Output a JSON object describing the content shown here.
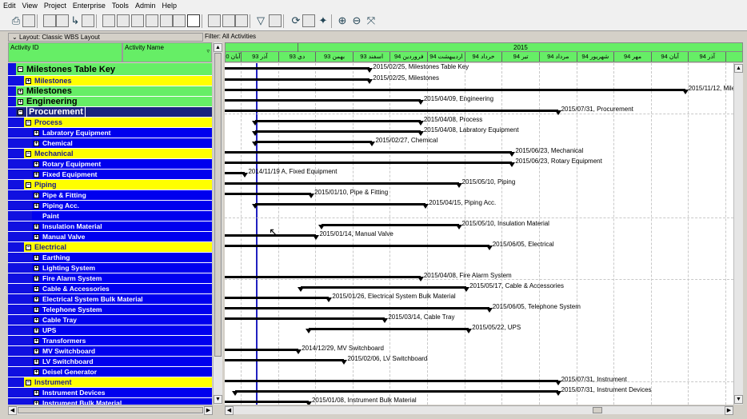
{
  "menu": [
    "Edit",
    "View",
    "Project",
    "Enterprise",
    "Tools",
    "Admin",
    "Help"
  ],
  "layout_label": "Layout: Classic WBS Layout",
  "filter_label": "Filter: All Activities",
  "columns": {
    "activity_id": "Activity ID",
    "activity_name": "Activity Name"
  },
  "timescale": {
    "year": "2015",
    "months": [
      "آبان 0",
      "آذر 93",
      "دي 93",
      "بهمن 93",
      "اسفند 93",
      "فروردين 94",
      "ارديبهشت 94",
      "خرداد 94",
      "تير 94",
      "مرداد 94",
      "شهريور 94",
      "مهر 94",
      "آبان 94",
      "آذر 94"
    ]
  },
  "rows": [
    {
      "label": "Milestones Table Key",
      "level": 0,
      "exp": "−",
      "big": true
    },
    {
      "label": "Milestones",
      "level": 1,
      "exp": "+"
    },
    {
      "label": "Milestones",
      "level": 0,
      "exp": "+"
    },
    {
      "label": "Engineering",
      "level": 0,
      "exp": "+"
    },
    {
      "label": "Procurement",
      "level": 0,
      "exp": "−",
      "sel": true
    },
    {
      "label": "Process",
      "level": 1,
      "exp": "−"
    },
    {
      "label": "Labratory Equipment",
      "level": 2,
      "exp": "+"
    },
    {
      "label": "Chemical",
      "level": 2,
      "exp": "+"
    },
    {
      "label": "Mechanical",
      "level": 1,
      "exp": "−"
    },
    {
      "label": "Rotary Equipment",
      "level": 2,
      "exp": "+"
    },
    {
      "label": "Fixed Equipment",
      "level": 2,
      "exp": "+"
    },
    {
      "label": "Piping",
      "level": 1,
      "exp": "−"
    },
    {
      "label": "Pipe & Fitting",
      "level": 2,
      "exp": "+"
    },
    {
      "label": "Piping Acc.",
      "level": 2,
      "exp": "+"
    },
    {
      "label": "Paint",
      "level": 2,
      "exp": ""
    },
    {
      "label": "Insulation Material",
      "level": 2,
      "exp": "+"
    },
    {
      "label": "Manual Valve",
      "level": 2,
      "exp": "+"
    },
    {
      "label": "Electrical",
      "level": 1,
      "exp": "−"
    },
    {
      "label": "Earthing",
      "level": 2,
      "exp": "+"
    },
    {
      "label": "Lighting System",
      "level": 2,
      "exp": "+"
    },
    {
      "label": "Fire Alarm System",
      "level": 2,
      "exp": "+"
    },
    {
      "label": "Cable & Accessories",
      "level": 2,
      "exp": "+"
    },
    {
      "label": "Electrical System Bulk Material",
      "level": 2,
      "exp": "+"
    },
    {
      "label": "Telephone System",
      "level": 2,
      "exp": "+"
    },
    {
      "label": "Cable Tray",
      "level": 2,
      "exp": "+"
    },
    {
      "label": "UPS",
      "level": 2,
      "exp": "+"
    },
    {
      "label": "Transformers",
      "level": 2,
      "exp": "+"
    },
    {
      "label": "MV Switchboard",
      "level": 2,
      "exp": "+"
    },
    {
      "label": "LV Switchboard",
      "level": 2,
      "exp": "+"
    },
    {
      "label": "Deisel Generator",
      "level": 2,
      "exp": "+"
    },
    {
      "label": "Instrument",
      "level": 1,
      "exp": "−"
    },
    {
      "label": "Instrument Devices",
      "level": 2,
      "exp": "+"
    },
    {
      "label": "Instrument Bulk Material",
      "level": 2,
      "exp": "+"
    }
  ],
  "bars": [
    {
      "label": "2015/02/25, Milestones Table Key",
      "start": 0.0,
      "end": 0.285
    },
    {
      "label": "2015/02/25, Milestones",
      "start": 0.0,
      "end": 0.285
    },
    {
      "label": "2015/11/12, Mile",
      "start": 0.0,
      "end": 0.905
    },
    {
      "label": "2015/04/09, Engineering",
      "start": 0.0,
      "end": 0.385
    },
    {
      "label": "2015/07/31, Procurement",
      "start": 0.0,
      "end": 0.655
    },
    {
      "label": "2015/04/08, Process",
      "start": 0.06,
      "end": 0.385
    },
    {
      "label": "2015/04/08, Labratory Equipment",
      "start": 0.06,
      "end": 0.385
    },
    {
      "label": "2015/02/27, Chemical",
      "start": 0.06,
      "end": 0.29
    },
    {
      "label": "2015/06/23, Mechanical",
      "start": 0.0,
      "end": 0.565
    },
    {
      "label": "2015/06/23, Rotary Equipment",
      "start": 0.0,
      "end": 0.565
    },
    {
      "label": "2014/11/19 A, Fixed Equipment",
      "start": 0.0,
      "end": 0.04
    },
    {
      "label": "2015/05/10, Piping",
      "start": 0.0,
      "end": 0.46
    },
    {
      "label": "2015/01/10, Pipe & Fitting",
      "start": 0.0,
      "end": 0.17
    },
    {
      "label": "2015/04/15, Piping Acc.",
      "start": 0.06,
      "end": 0.395
    },
    {
      "label": "",
      "start": 0,
      "end": 0
    },
    {
      "label": "2015/05/10, Insulation Material",
      "start": 0.19,
      "end": 0.46
    },
    {
      "label": "2015/01/14, Manual Valve",
      "start": 0.0,
      "end": 0.18
    },
    {
      "label": "2015/06/05, Electrical",
      "start": 0.0,
      "end": 0.52
    },
    {
      "label": "",
      "start": 0,
      "end": 0
    },
    {
      "label": "",
      "start": 0,
      "end": 0
    },
    {
      "label": "2015/04/08, Fire Alarm System",
      "start": 0.0,
      "end": 0.385
    },
    {
      "label": "2015/05/17, Cable & Accessories",
      "start": 0.15,
      "end": 0.475
    },
    {
      "label": "2015/01/26, Electrical System Bulk Material",
      "start": 0.0,
      "end": 0.205
    },
    {
      "label": "2015/06/05, Telephone System",
      "start": 0.0,
      "end": 0.52
    },
    {
      "label": "2015/03/14, Cable Tray",
      "start": 0.0,
      "end": 0.315
    },
    {
      "label": "2015/05/22, UPS",
      "start": 0.165,
      "end": 0.48
    },
    {
      "label": "",
      "start": 0,
      "end": 0
    },
    {
      "label": "2014/12/29, MV Switchboard",
      "start": 0.0,
      "end": 0.145
    },
    {
      "label": "2015/02/06, LV Switchboard",
      "start": 0.0,
      "end": 0.235
    },
    {
      "label": "",
      "start": 0,
      "end": 0
    },
    {
      "label": "2015/07/31, Instrument",
      "start": 0.0,
      "end": 0.655
    },
    {
      "label": "2015/07/31, Instrument Devices",
      "start": 0.02,
      "end": 0.655
    },
    {
      "label": "2015/01/08, Instrument Bulk Material",
      "start": 0.0,
      "end": 0.165
    }
  ]
}
